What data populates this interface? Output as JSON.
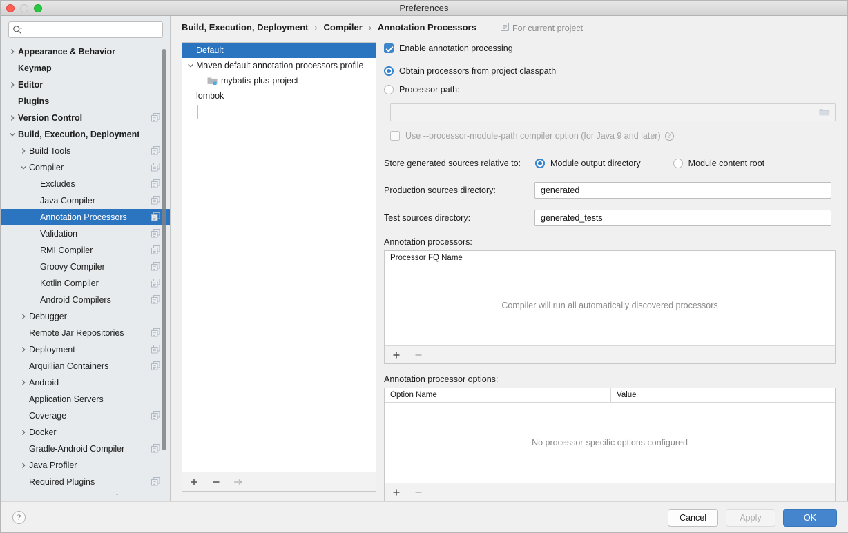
{
  "window": {
    "title": "Preferences"
  },
  "search": {
    "value": "",
    "placeholder": ""
  },
  "sidebar": {
    "items": [
      {
        "label": "Appearance & Behavior",
        "twisty": "right",
        "bold": true,
        "indent": 0,
        "scope": false
      },
      {
        "label": "Keymap",
        "twisty": "none",
        "bold": true,
        "indent": 0,
        "scope": false
      },
      {
        "label": "Editor",
        "twisty": "right",
        "bold": true,
        "indent": 0,
        "scope": false
      },
      {
        "label": "Plugins",
        "twisty": "none",
        "bold": true,
        "indent": 0,
        "scope": false
      },
      {
        "label": "Version Control",
        "twisty": "right",
        "bold": true,
        "indent": 0,
        "scope": true
      },
      {
        "label": "Build, Execution, Deployment",
        "twisty": "down",
        "bold": true,
        "indent": 0,
        "scope": false
      },
      {
        "label": "Build Tools",
        "twisty": "right",
        "bold": false,
        "indent": 1,
        "scope": true
      },
      {
        "label": "Compiler",
        "twisty": "down",
        "bold": false,
        "indent": 1,
        "scope": true
      },
      {
        "label": "Excludes",
        "twisty": "none",
        "bold": false,
        "indent": 2,
        "scope": true
      },
      {
        "label": "Java Compiler",
        "twisty": "none",
        "bold": false,
        "indent": 2,
        "scope": true
      },
      {
        "label": "Annotation Processors",
        "twisty": "none",
        "bold": false,
        "indent": 2,
        "scope": true,
        "selected": true
      },
      {
        "label": "Validation",
        "twisty": "none",
        "bold": false,
        "indent": 2,
        "scope": true
      },
      {
        "label": "RMI Compiler",
        "twisty": "none",
        "bold": false,
        "indent": 2,
        "scope": true
      },
      {
        "label": "Groovy Compiler",
        "twisty": "none",
        "bold": false,
        "indent": 2,
        "scope": true
      },
      {
        "label": "Kotlin Compiler",
        "twisty": "none",
        "bold": false,
        "indent": 2,
        "scope": true
      },
      {
        "label": "Android Compilers",
        "twisty": "none",
        "bold": false,
        "indent": 2,
        "scope": true
      },
      {
        "label": "Debugger",
        "twisty": "right",
        "bold": false,
        "indent": 1,
        "scope": false
      },
      {
        "label": "Remote Jar Repositories",
        "twisty": "none",
        "bold": false,
        "indent": 1,
        "scope": true
      },
      {
        "label": "Deployment",
        "twisty": "right",
        "bold": false,
        "indent": 1,
        "scope": true
      },
      {
        "label": "Arquillian Containers",
        "twisty": "none",
        "bold": false,
        "indent": 1,
        "scope": true
      },
      {
        "label": "Android",
        "twisty": "right",
        "bold": false,
        "indent": 1,
        "scope": false
      },
      {
        "label": "Application Servers",
        "twisty": "none",
        "bold": false,
        "indent": 1,
        "scope": false
      },
      {
        "label": "Coverage",
        "twisty": "none",
        "bold": false,
        "indent": 1,
        "scope": true
      },
      {
        "label": "Docker",
        "twisty": "right",
        "bold": false,
        "indent": 1,
        "scope": false
      },
      {
        "label": "Gradle-Android Compiler",
        "twisty": "none",
        "bold": false,
        "indent": 1,
        "scope": true
      },
      {
        "label": "Java Profiler",
        "twisty": "right",
        "bold": false,
        "indent": 1,
        "scope": false
      },
      {
        "label": "Required Plugins",
        "twisty": "none",
        "bold": false,
        "indent": 1,
        "scope": true
      },
      {
        "label": "Languages & Frameworks",
        "twisty": "right",
        "bold": true,
        "indent": 0,
        "scope": false
      }
    ]
  },
  "breadcrumb": {
    "parts": [
      "Build, Execution, Deployment",
      "Compiler",
      "Annotation Processors"
    ],
    "separator": "›",
    "scope_note": "For current project"
  },
  "profiles": {
    "rows": [
      {
        "label": "Default",
        "twisty": "none",
        "indent": 0,
        "selected": true,
        "icon": "none"
      },
      {
        "label": "Maven default annotation processors profile",
        "twisty": "down",
        "indent": 0,
        "selected": false,
        "icon": "none"
      },
      {
        "label": "mybatis-plus-project",
        "twisty": "none",
        "indent": 1,
        "selected": false,
        "icon": "project"
      },
      {
        "label": "lombok",
        "twisty": "none",
        "indent": 0,
        "selected": false,
        "icon": "none"
      }
    ],
    "toolbar": {
      "add": "+",
      "remove": "−",
      "move": "→"
    }
  },
  "settings": {
    "enable_annotation_processing": {
      "label": "Enable annotation processing",
      "checked": true
    },
    "source_mode": {
      "obtain_from_classpath": {
        "label": "Obtain processors from project classpath",
        "selected": true
      },
      "processor_path": {
        "label": "Processor path:",
        "selected": false,
        "value": "",
        "browse_icon": "folder-icon"
      }
    },
    "processor_module_path": {
      "label": "Use --processor-module-path compiler option (for Java 9 and later)",
      "checked": false,
      "enabled": false,
      "help_glyph": "?"
    },
    "store_relative": {
      "label": "Store generated sources relative to:",
      "options": [
        {
          "label": "Module output directory",
          "selected": true
        },
        {
          "label": "Module content root",
          "selected": false
        }
      ]
    },
    "production_sources": {
      "label": "Production sources directory:",
      "value": "generated"
    },
    "test_sources": {
      "label": "Test sources directory:",
      "value": "generated_tests"
    },
    "processors_table": {
      "label": "Annotation processors:",
      "columns": [
        "Processor FQ Name"
      ],
      "rows": [],
      "empty_text": "Compiler will run all automatically discovered processors",
      "toolbar": {
        "add": "+",
        "remove": "−"
      }
    },
    "options_table": {
      "label": "Annotation processor options:",
      "columns": [
        "Option Name",
        "Value"
      ],
      "rows": [],
      "empty_text": "No processor-specific options configured",
      "toolbar": {
        "add": "+",
        "remove": "−"
      }
    }
  },
  "footer": {
    "help": "?",
    "cancel": "Cancel",
    "apply": "Apply",
    "apply_enabled": false,
    "ok": "OK"
  },
  "colors": {
    "selection_blue": "#2A74C0",
    "accent_blue": "#3E87C9",
    "primary_button": "#4585CE",
    "sidebar_bg": "#E7EBEE",
    "panel_bg": "#F0F0F0"
  }
}
